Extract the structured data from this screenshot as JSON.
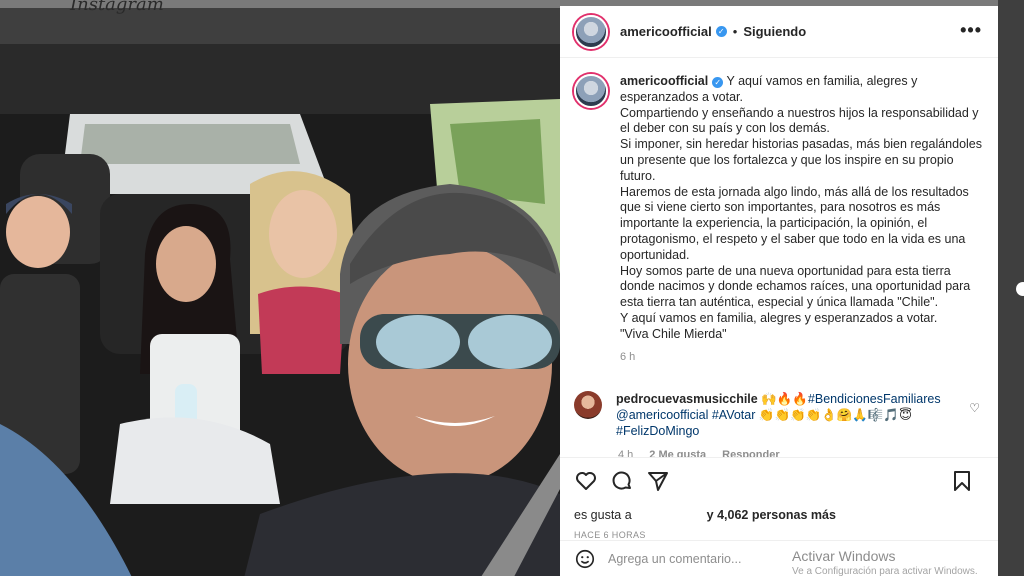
{
  "backdrop": {
    "logo": "Instagram"
  },
  "post": {
    "username": "americoofficial",
    "follow_status": "Siguiendo",
    "separator": "•",
    "caption": "Y aquí vamos en familia, alegres y esperanzados a votar.\nCompartiendo y enseñando a nuestros hijos la responsabilidad y el deber con su país y con los demás.\nSi imponer, sin heredar historias pasadas, más bien regalándoles un presente que los fortalezca y que los inspire en su propio futuro.\nHaremos de esta jornada algo lindo, más allá de los resultados que si viene cierto son importantes, para nosotros es más importante la experiencia, la participación, la opinión, el protagonismo, el respeto y el saber que todo en la vida es una oportunidad.\nHoy somos parte de una nueva oportunidad para esta tierra donde nacimos y donde echamos raíces, una oportunidad para esta tierra tan auténtica, especial y única llamada \"Chile\".\nY aquí vamos en familia, alegres y esperanzados a votar.\n\"Viva Chile Mierda\"",
    "caption_age": "6 h",
    "likes_prefix": "es gusta a",
    "likes_count_text": "y 4,062 personas más",
    "timestamp": "HACE 6 HORAS",
    "comment_placeholder": "Agrega un comentario..."
  },
  "comment": {
    "username": "pedrocuevasmusicchile",
    "emoji_lead": "🙌🔥🔥",
    "hashtag1": "#BendicionesFamiliares",
    "mention": "@americoofficial",
    "hashtag2": "#AVotar",
    "emoji_tail": "👏👏👏👏👌🤗🙏🎼🎵😇",
    "hashtag3": "#FelizDoMingo",
    "age": "4 h",
    "likes": "2 Me gusta",
    "reply": "Responder"
  },
  "os_watermark": {
    "title": "Activar Windows",
    "subtitle": "Ve a Configuración para activar Windows."
  },
  "icons": [
    "verified-badge-icon",
    "more-options-icon",
    "heart-icon",
    "comment-icon",
    "share-icon",
    "bookmark-icon",
    "emoji-icon"
  ]
}
